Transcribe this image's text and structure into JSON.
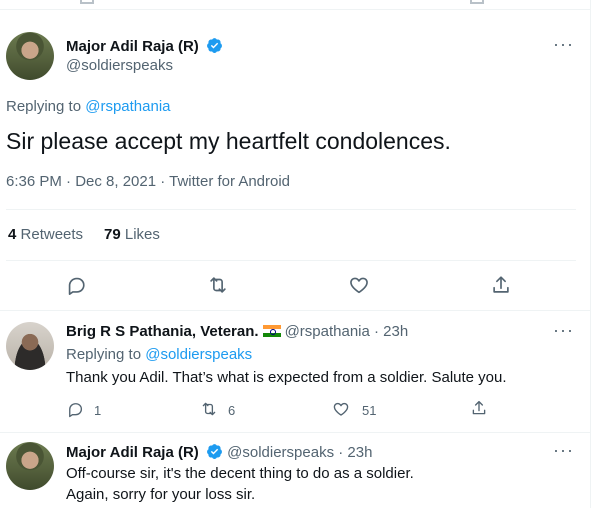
{
  "colors": {
    "accent": "#1d9bf0",
    "text": "#0f1419",
    "muted": "#536471",
    "border": "#eff3f4"
  },
  "main_tweet": {
    "author_name": "Major Adil Raja (R)",
    "author_handle": "@soldierspeaks",
    "replying_to_prefix": "Replying to",
    "replying_to_handle": "@rspathania",
    "text": "Sir please accept my heartfelt condolences.",
    "timestamp": "6:36 PM · Dec 8, 2021 · Twitter for Android",
    "retweets_count": "4",
    "retweets_label": "Retweets",
    "likes_count": "79",
    "likes_label": "Likes",
    "more_label": "···"
  },
  "reply_1": {
    "author_name": "Brig R S Pathania, Veteran.",
    "author_handle": "@rspathania",
    "time": "· 23h",
    "replying_to_prefix": "Replying to",
    "replying_to_handle": "@soldierspeaks",
    "text": "Thank you Adil. That’s what is expected from a soldier. Salute you.",
    "replies": "1",
    "retweets": "6",
    "likes": "51",
    "more_label": "···"
  },
  "reply_2": {
    "author_name": "Major Adil Raja (R)",
    "author_handle": "@soldierspeaks",
    "time": "· 23h",
    "text_line1": "Off-course sir, it's the decent thing to do as a soldier.",
    "text_line2": "Again, sorry for your loss sir.",
    "more_label": "···"
  }
}
